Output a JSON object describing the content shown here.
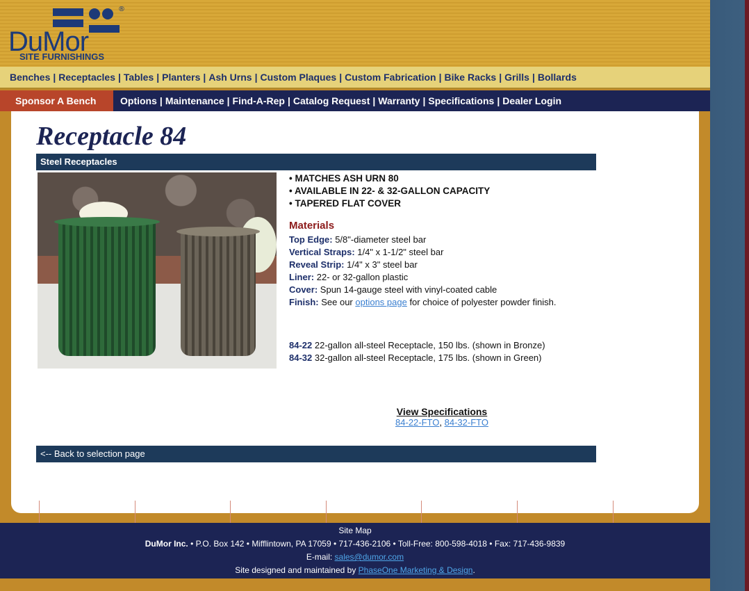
{
  "logo": {
    "name": "DuMor",
    "sub": "SITE FURNISHINGS",
    "reg": "®"
  },
  "nav_primary": [
    "Benches",
    "Receptacles",
    "Tables",
    "Planters",
    "Ash Urns",
    "Custom Plaques",
    "Custom Fabrication",
    "Bike Racks",
    "Grills",
    "Bollards"
  ],
  "nav_secondary": {
    "highlight": "Sponsor A Bench",
    "items": [
      "Options",
      "Maintenance",
      "Find-A-Rep",
      "Catalog Request",
      "Warranty",
      "Specifications",
      "Dealer Login"
    ]
  },
  "product": {
    "title": "Receptacle 84",
    "category": "Steel Receptacles",
    "bullets": [
      "• MATCHES ASH URN 80",
      "• AVAILABLE IN 22- & 32-GALLON CAPACITY",
      "• TAPERED FLAT COVER"
    ],
    "materials_heading": "Materials",
    "materials": [
      {
        "k": "Top Edge:",
        "v": " 5/8\"-diameter steel bar"
      },
      {
        "k": "Vertical Straps:",
        "v": " 1/4\" x 1-1/2\" steel bar"
      },
      {
        "k": "Reveal Strip:",
        "v": " 1/4\" x 3\" steel bar"
      },
      {
        "k": "Liner:",
        "v": " 22- or 32-gallon plastic"
      },
      {
        "k": "Cover:",
        "v": " Spun 14-gauge steel with vinyl-coated cable"
      }
    ],
    "finish": {
      "k": "Finish:",
      "pre": " See our ",
      "link": "options page",
      "post": " for choice of polyester powder finish."
    },
    "models": [
      {
        "k": "84-22",
        "v": " 22-gallon all-steel Receptacle, 150 lbs. (shown in Bronze)"
      },
      {
        "k": "84-32",
        "v": " 32-gallon all-steel Receptacle, 175 lbs. (shown in Green)"
      }
    ],
    "specs_heading": "View Specifications",
    "spec_links": [
      "84-22-FTO",
      "84-32-FTO"
    ],
    "back_link": "<-- Back to selection page"
  },
  "footer": {
    "sitemap": "Site Map",
    "company": "DuMor Inc.",
    "address": " • P.O. Box 142 • Mifflintown, PA 17059 • 717-436-2106 • Toll-Free: 800-598-4018 • Fax: 717-436-9839",
    "email_label": "E-mail: ",
    "email": "sales@dumor.com",
    "credit_pre": "Site designed and maintained by ",
    "credit_link": "PhaseOne Marketing & Design",
    "credit_post": "."
  },
  "colors": {
    "navy": "#1c2454",
    "gold": "#c28a2a",
    "sponsor": "#b8452a",
    "materials": "#8c1a1a"
  }
}
